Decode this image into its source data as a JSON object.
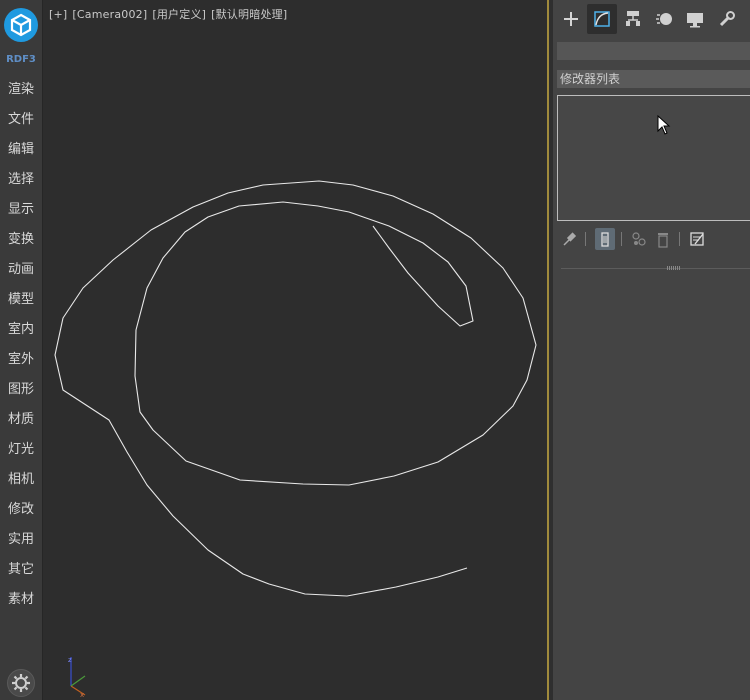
{
  "app": {
    "brand": "RDF3"
  },
  "left_menu": {
    "items": [
      "渲染",
      "文件",
      "编辑",
      "选择",
      "显示",
      "变换",
      "动画",
      "模型",
      "室内",
      "室外",
      "图形",
      "材质",
      "灯光",
      "相机",
      "修改",
      "实用",
      "其它",
      "素材"
    ]
  },
  "viewport": {
    "label_parts": [
      "[+]",
      "[Camera002]",
      "[用户定义]",
      "[默认明暗处理]"
    ]
  },
  "command_panel": {
    "tabs": [
      {
        "name": "create",
        "icon": "plus-icon"
      },
      {
        "name": "modify",
        "icon": "modify-curve-icon"
      },
      {
        "name": "hierarchy",
        "icon": "hierarchy-icon"
      },
      {
        "name": "motion",
        "icon": "motion-icon"
      },
      {
        "name": "display",
        "icon": "display-monitor-icon"
      },
      {
        "name": "utilities",
        "icon": "wrench-icon"
      }
    ],
    "active_tab": "modify",
    "object_name": "",
    "modifier_list_label": "修改器列表",
    "stack_tools": [
      "pin-stack-icon",
      "show-end-result-icon",
      "make-unique-icon",
      "remove-modifier-icon",
      "configure-modifier-sets-icon"
    ]
  },
  "colors": {
    "accent_divider": "#a08a3c",
    "logo_blue": "#1f9ae0",
    "spline_stroke": "#e8e8e8"
  }
}
